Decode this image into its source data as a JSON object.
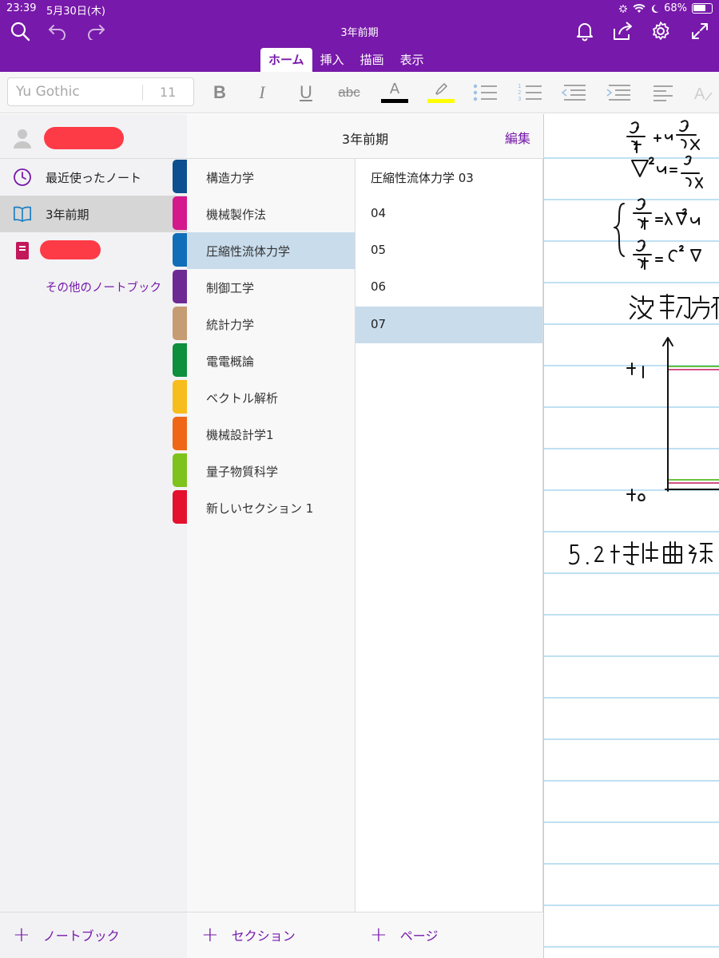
{
  "status": {
    "time": "23:39",
    "date": "5月30日(木)",
    "battery": "68%"
  },
  "app": {
    "title": "3年前期",
    "tabs": [
      {
        "label": "ホーム",
        "active": true
      },
      {
        "label": "挿入",
        "active": false
      },
      {
        "label": "描画",
        "active": false
      },
      {
        "label": "表示",
        "active": false
      }
    ]
  },
  "toolbar": {
    "font_name": "Yu Gothic",
    "font_size": "11",
    "strikethrough_label": "abc",
    "font_color_glyph": "A",
    "font_color": "#000000",
    "highlight_color": "#ffff00"
  },
  "notebooks": {
    "items": [
      {
        "label": "最近使ったノート",
        "icon": "clock-icon",
        "selected": false
      },
      {
        "label": "3年前期",
        "icon": "open-book-icon",
        "selected": true
      }
    ],
    "more": "その他のノートブック",
    "add": "ノートブック"
  },
  "sections": {
    "header": "3年前期",
    "edit": "編集",
    "items": [
      {
        "label": "構造力学",
        "color": "#0e4f8f"
      },
      {
        "label": "機械製作法",
        "color": "#d3198c"
      },
      {
        "label": "圧縮性流体力学",
        "color": "#106eb8",
        "selected": true
      },
      {
        "label": "制御工学",
        "color": "#6e2a93"
      },
      {
        "label": "統計力学",
        "color": "#c69c72"
      },
      {
        "label": "電電概論",
        "color": "#0d8f3d"
      },
      {
        "label": "ベクトル解析",
        "color": "#f7bd1c"
      },
      {
        "label": "機械設計学1",
        "color": "#ef6616"
      },
      {
        "label": "量子物質科学",
        "color": "#7ec21c"
      },
      {
        "label": "新しいセクション 1",
        "color": "#e3112e"
      }
    ],
    "add": "セクション"
  },
  "pages": {
    "items": [
      {
        "label": "圧縮性流体力学 03"
      },
      {
        "label": "04"
      },
      {
        "label": "05"
      },
      {
        "label": "06"
      },
      {
        "label": "07",
        "selected": true
      }
    ],
    "add": "ページ"
  },
  "colors": {
    "brand": "#7719aa",
    "selection": "#c8dcec",
    "rule_line": "#bfe0f2"
  }
}
